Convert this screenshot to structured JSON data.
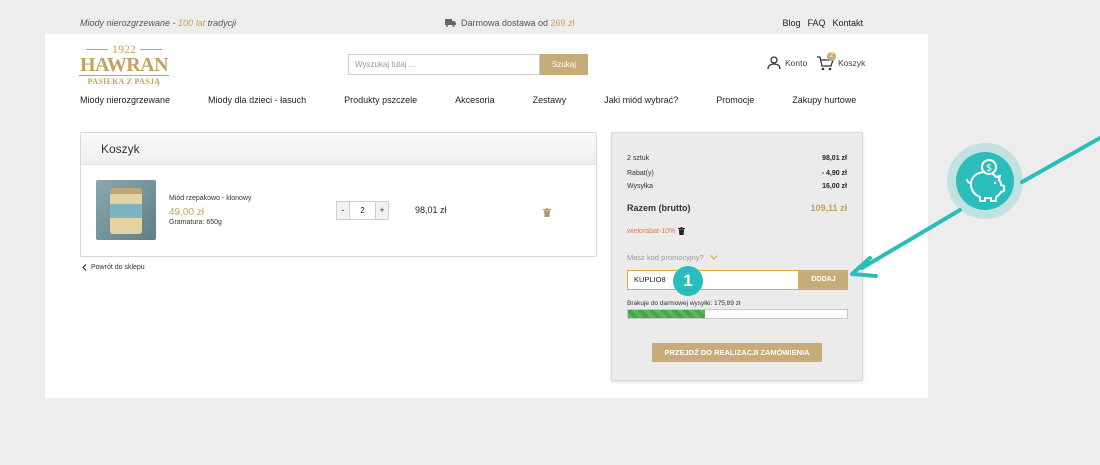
{
  "topbar": {
    "tagline_prefix": "Miody nierozgrzewane - ",
    "tagline_accent": "100 lat",
    "tagline_suffix": " tradycji",
    "shipping_prefix": "Darmowa dostawa",
    "shipping_mid": " od ",
    "shipping_amount": "269 zł",
    "links": [
      "Blog",
      "FAQ",
      "Kontakt"
    ]
  },
  "logo": {
    "year": "1922",
    "brand": "HAWRAN",
    "tag": "PASIEKA Z PASJĄ"
  },
  "search": {
    "placeholder": "Wyszukaj tutaj ...",
    "button": "Szukaj"
  },
  "account": {
    "label": "Konto"
  },
  "cart_header": {
    "label": "Koszyk",
    "count": "2"
  },
  "nav": [
    "Miody nierozgrzewane",
    "Miody dla dzieci - łasuch",
    "Produkty pszczele",
    "Akcesoria",
    "Zestawy",
    "Jaki miód wybrać?",
    "Promocje",
    "Zakupy hurtowe"
  ],
  "cart": {
    "title": "Koszyk",
    "item": {
      "name": "Miód rzepakowo - klonowy",
      "price": "49,00 zł",
      "gramatura": "Gramatura: 650g",
      "qty": "2",
      "line_total": "98,01 zł"
    },
    "back": "Powrót do sklepu"
  },
  "summary": {
    "rows": [
      {
        "label": "2 sztuk",
        "value": "98,01 zł"
      },
      {
        "label": "Rabat(y)",
        "value": "- 4,90 zł"
      },
      {
        "label": "Wysyłka",
        "value": "16,00 zł"
      }
    ],
    "total_label": "Razem (brutto)",
    "total_value": "109,11 zł",
    "discount_tag": "wielorabat-10%",
    "promo_question": "Masz kod promocyjny?",
    "promo_value": "KUPLIO8",
    "promo_button": "DODAJ",
    "free_ship_label": "Brakuje do darmowej wysyłki:",
    "free_ship_amount": "175,89 zł",
    "free_ship_progress": 0.35,
    "cta": "PRZEJDŹ DO REALIZACJI ZAMÓWIENIA"
  },
  "annotation": {
    "step": "1"
  },
  "colors": {
    "accent": "#c3a25e",
    "button": "#c7ab79",
    "teal": "#2bbcbc",
    "progress": "#58b85c"
  }
}
